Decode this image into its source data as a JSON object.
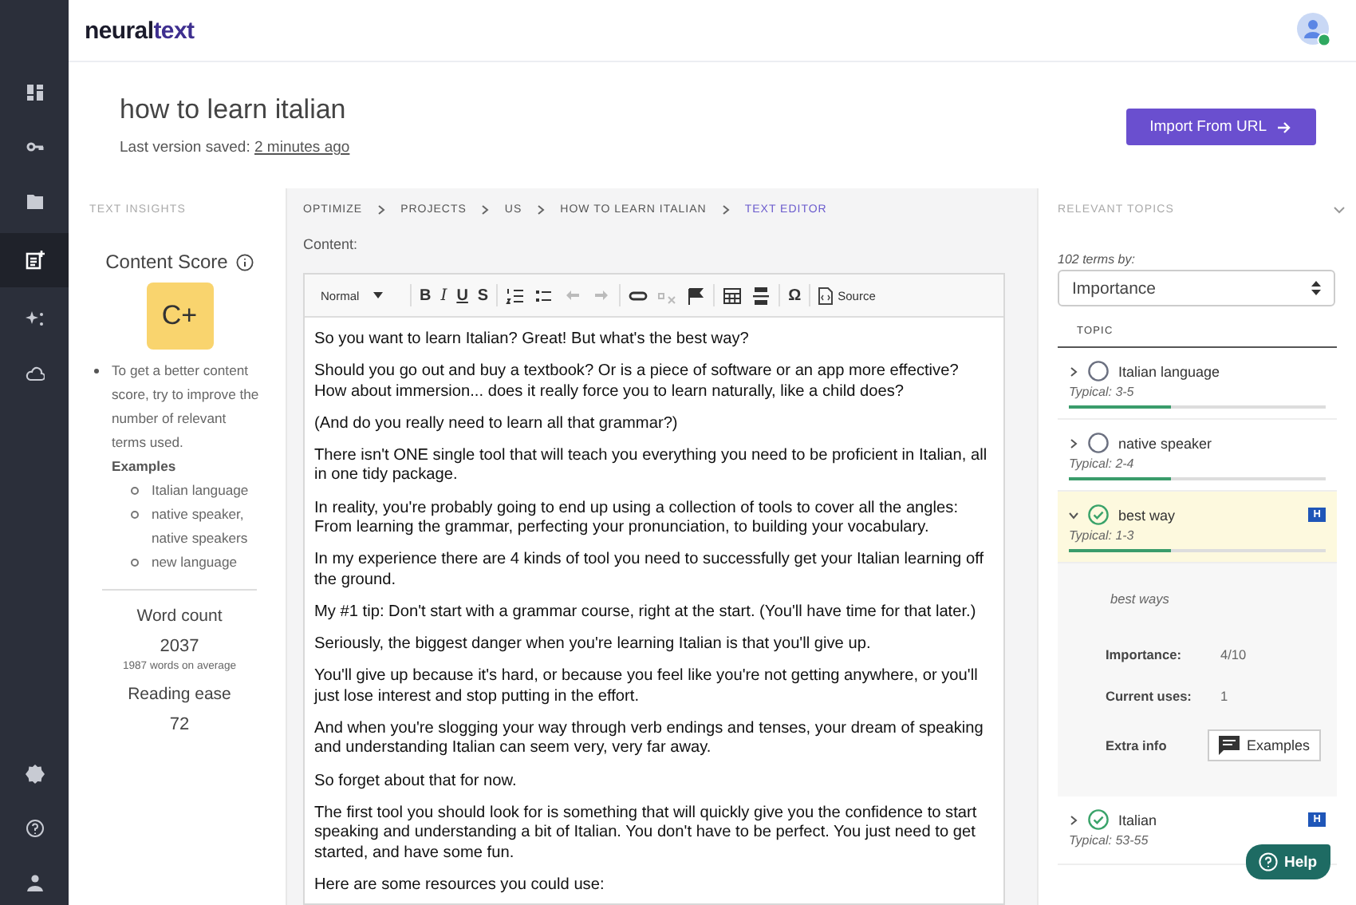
{
  "logo": {
    "text": "neural",
    "accent": "text"
  },
  "nav": [
    {
      "kind": "dashboard",
      "selected": false
    },
    {
      "kind": "key",
      "selected": false
    },
    {
      "kind": "folder",
      "selected": false
    },
    {
      "kind": "editor",
      "selected": true
    },
    {
      "kind": "sparkle",
      "selected": false
    },
    {
      "kind": "cloud",
      "selected": false
    }
  ],
  "nav_bottom": [
    {
      "kind": "badge"
    },
    {
      "kind": "help"
    },
    {
      "kind": "user"
    }
  ],
  "page": {
    "title": "how to learn italian",
    "saved_label": "Last version saved:",
    "saved_time": "2 minutes ago",
    "import_button": "Import From URL"
  },
  "insights": {
    "heading": "TEXT INSIGHTS",
    "score_title": "Content Score",
    "score": "C+",
    "tip": "To get a better content score, try to improve the number of relevant terms used.",
    "examples_label": "Examples",
    "examples": [
      "Italian language",
      "native speaker, native speakers",
      "new language"
    ],
    "stats": [
      {
        "label": "Word count",
        "value": "2037",
        "note": "1987 words on average"
      },
      {
        "label": "Reading ease",
        "value": "72"
      }
    ]
  },
  "breadcrumb": [
    {
      "label": "OPTIMIZE",
      "selected": false
    },
    {
      "label": "PROJECTS",
      "selected": false
    },
    {
      "label": "US",
      "selected": false
    },
    {
      "label": "HOW TO LEARN ITALIAN",
      "selected": false
    },
    {
      "label": "TEXT EDITOR",
      "selected": true
    }
  ],
  "content_label": "Content:",
  "toolbar": {
    "format": "Normal",
    "buttons": [
      {
        "kind": "bold",
        "label": "B",
        "disabled": false
      },
      {
        "kind": "italic",
        "label": "I",
        "disabled": false
      },
      {
        "kind": "underline",
        "label": "U",
        "disabled": false
      },
      {
        "kind": "strike",
        "label": "S",
        "disabled": false
      },
      {
        "kind": "ordered-list",
        "disabled": false
      },
      {
        "kind": "bullet-list",
        "disabled": false
      },
      {
        "kind": "undo",
        "disabled": true
      },
      {
        "kind": "redo",
        "disabled": true
      },
      {
        "kind": "link",
        "disabled": false
      },
      {
        "kind": "unlink",
        "disabled": true
      },
      {
        "kind": "flag",
        "disabled": false
      },
      {
        "kind": "table",
        "disabled": false
      },
      {
        "kind": "rule",
        "disabled": false
      },
      {
        "kind": "symbol",
        "label": "Ω",
        "disabled": false
      },
      {
        "kind": "source",
        "label": "Source",
        "disabled": false
      }
    ]
  },
  "paragraphs": [
    "So you want to learn Italian? Great! But what's the best way?",
    "Should you go out and buy a textbook? Or is a piece of software or an app more effective? How about immersion... does it really force you to learn naturally, like a child does?",
    "(And do you really need to learn all that grammar?)",
    "There isn't ONE single tool that will teach you everything you need to be proficient in Italian, all in one tidy package.",
    "In reality, you're probably going to end up using a collection of tools to cover all the angles: From learning the grammar, perfecting your pronunciation, to building your vocabulary.",
    "In my experience there are 4 kinds of tool you need to successfully get your Italian learning off the ground.",
    "My #1 tip: Don't start with a grammar course, right at the start. (You'll have time for that later.)",
    "Seriously, the biggest danger when you're learning Italian is that you'll give up.",
    "You'll give up because it's hard, or because you feel like you're not getting anywhere, or you'll just lose interest and stop putting in the effort.",
    "And when you're slogging your way through verb endings and tenses, your dream of speaking and understanding Italian can seem very, very far away.",
    "So forget about that for now.",
    "The first tool you should look for is something that will quickly give you the confidence to start speaking and understanding a bit of Italian. You don't have to be perfect. You just need to get started, and have some fun.",
    "Here are some resources you could use:"
  ],
  "topics": {
    "heading": "RELEVANT TOPICS",
    "count_label": "102 terms by:",
    "sort": "Importance",
    "column": "TOPIC",
    "items": [
      {
        "name": "Italian language",
        "typical": "Typical: 3-5",
        "level": 0.4,
        "checked": false,
        "expanded": false
      },
      {
        "name": "native speaker",
        "typical": "Typical: 2-4",
        "level": 0.4,
        "checked": false,
        "expanded": false
      },
      {
        "name": "best way",
        "typical": "Typical: 1-3",
        "level": 0.4,
        "checked": true,
        "expanded": true,
        "badge": "H",
        "variant": "best ways",
        "importance_label": "Importance:",
        "importance": "4/10",
        "uses_label": "Current uses:",
        "uses": "1",
        "extra_label": "Extra info",
        "examples_button": "Examples"
      },
      {
        "name": "Italian",
        "typical": "Typical: 53-55",
        "checked": true,
        "expanded": false,
        "badge": "H"
      }
    ]
  },
  "help_button": "Help"
}
